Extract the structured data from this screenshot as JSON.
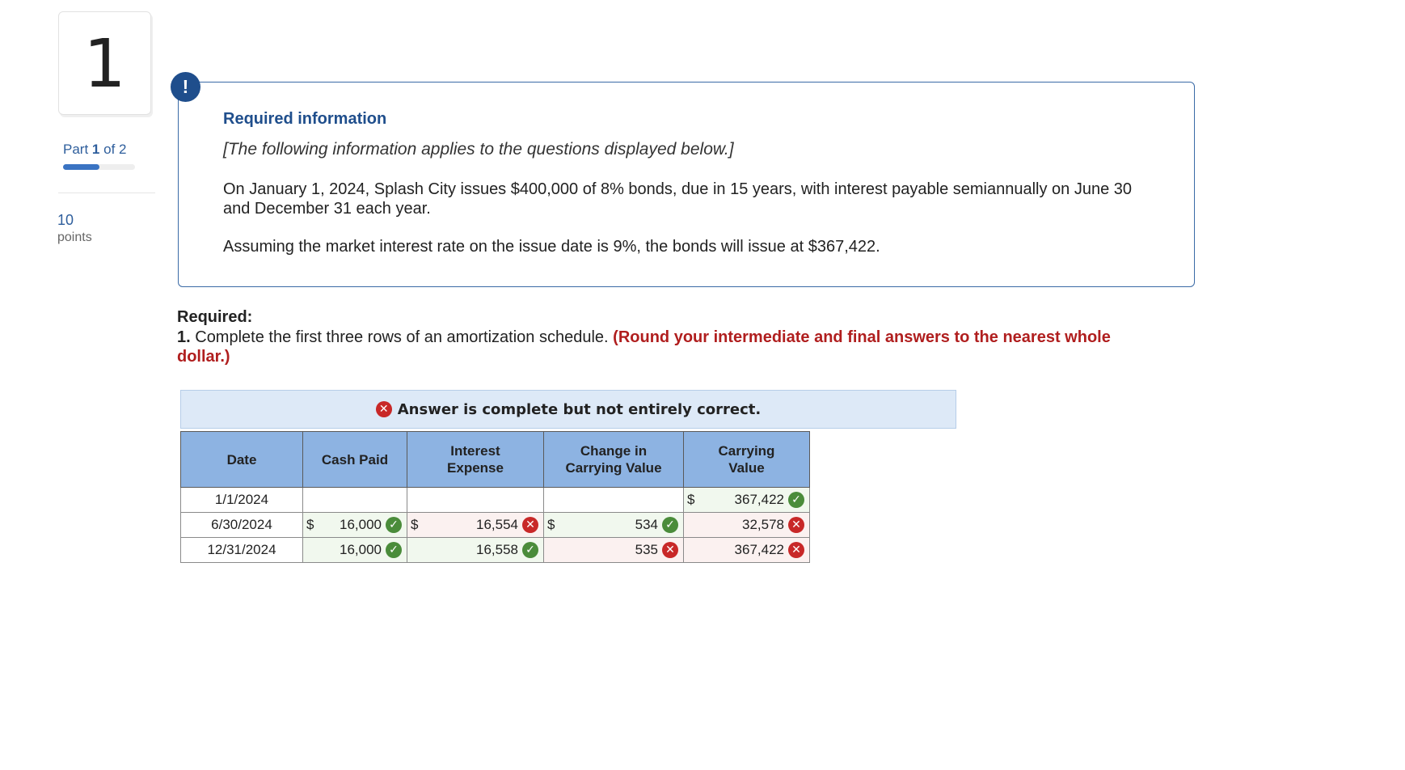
{
  "question": {
    "number": "1",
    "part_prefix": "Part",
    "part_current": "1",
    "part_suffix": "of 2",
    "progress": 0.5,
    "points": "10",
    "points_label": "points"
  },
  "info": {
    "alert_symbol": "!",
    "title": "Required information",
    "applies_note": "[The following information applies to the questions displayed below.]",
    "paragraph1": "On January 1, 2024, Splash City issues $400,000 of 8% bonds, due in 15 years, with interest payable semiannually on June 30 and December 31 each year.",
    "paragraph2": "Assuming the market interest rate on the issue date is 9%, the bonds will issue at $367,422."
  },
  "required": {
    "heading": "Required:",
    "item_number": "1.",
    "text": " Complete the first three rows of an amortization schedule. ",
    "instruction": "(Round your intermediate and final answers to the nearest whole dollar.)"
  },
  "result": {
    "message": "Answer is complete but not entirely correct.",
    "icon": "x-circle-icon"
  },
  "table": {
    "headers": {
      "date": "Date",
      "cash_paid": "Cash Paid",
      "interest_expense_1": "Interest",
      "interest_expense_2": "Expense",
      "change_1": "Change in",
      "change_2": "Carrying Value",
      "carrying_1": "Carrying",
      "carrying_2": "Value"
    },
    "currency": "$",
    "rows": [
      {
        "date": "1/1/2024",
        "cash_paid": "",
        "cash_status": "",
        "interest": "",
        "interest_status": "",
        "change": "",
        "change_status": "",
        "carrying": "367,422",
        "carrying_status": "correct"
      },
      {
        "date": "6/30/2024",
        "cash_paid": "16,000",
        "cash_status": "correct",
        "interest": "16,554",
        "interest_status": "incorrect",
        "change": "534",
        "change_status": "correct",
        "carrying": "32,578",
        "carrying_status": "incorrect"
      },
      {
        "date": "12/31/2024",
        "cash_paid": "16,000",
        "cash_status": "correct",
        "interest": "16,558",
        "interest_status": "correct",
        "change": "535",
        "change_status": "incorrect",
        "carrying": "367,422",
        "carrying_status": "incorrect"
      }
    ],
    "status_icons": {
      "correct": "✓",
      "incorrect": "✕"
    },
    "status_colors": {
      "correct": "#4a8c3a",
      "incorrect": "#c82828",
      "correct_bg": "#f1f8ee",
      "incorrect_bg": "#fbf1f0"
    }
  }
}
